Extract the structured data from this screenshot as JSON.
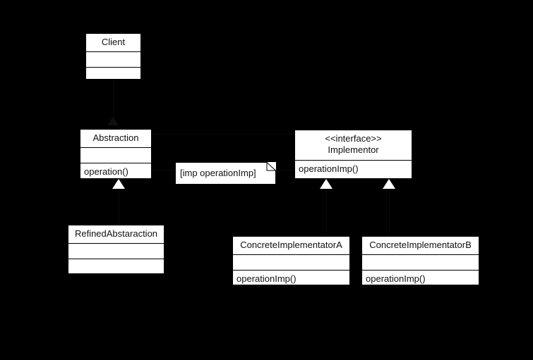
{
  "diagram": {
    "type": "uml-class-diagram",
    "pattern": "Bridge",
    "background_color": "#000000",
    "box_fill": "#ffffff",
    "text_color": "#111111",
    "arrow_fill": "#ffffff"
  },
  "classes": {
    "client": {
      "name": "Client",
      "attributes": "",
      "operations": ""
    },
    "abstraction": {
      "name": "Abstraction",
      "attributes": "",
      "operations": "operation()"
    },
    "implementor": {
      "stereotype": "<<interface>>",
      "name": "Implementor",
      "operations": "operationImp()"
    },
    "refined_abstraction": {
      "name": "RefinedAbstaraction",
      "attributes": "",
      "operations": ""
    },
    "concrete_implementator_a": {
      "name": "ConcreteImplementatorA",
      "attributes": "",
      "operations": "operationImp()"
    },
    "concrete_implementator_b": {
      "name": "ConcreteImplementatorB",
      "attributes": "",
      "operations": "operationImp()"
    }
  },
  "note": {
    "text": "[imp operationImp]"
  },
  "edge_labels": {
    "client_to_abstraction": "",
    "abstraction_to_implementor": ""
  }
}
